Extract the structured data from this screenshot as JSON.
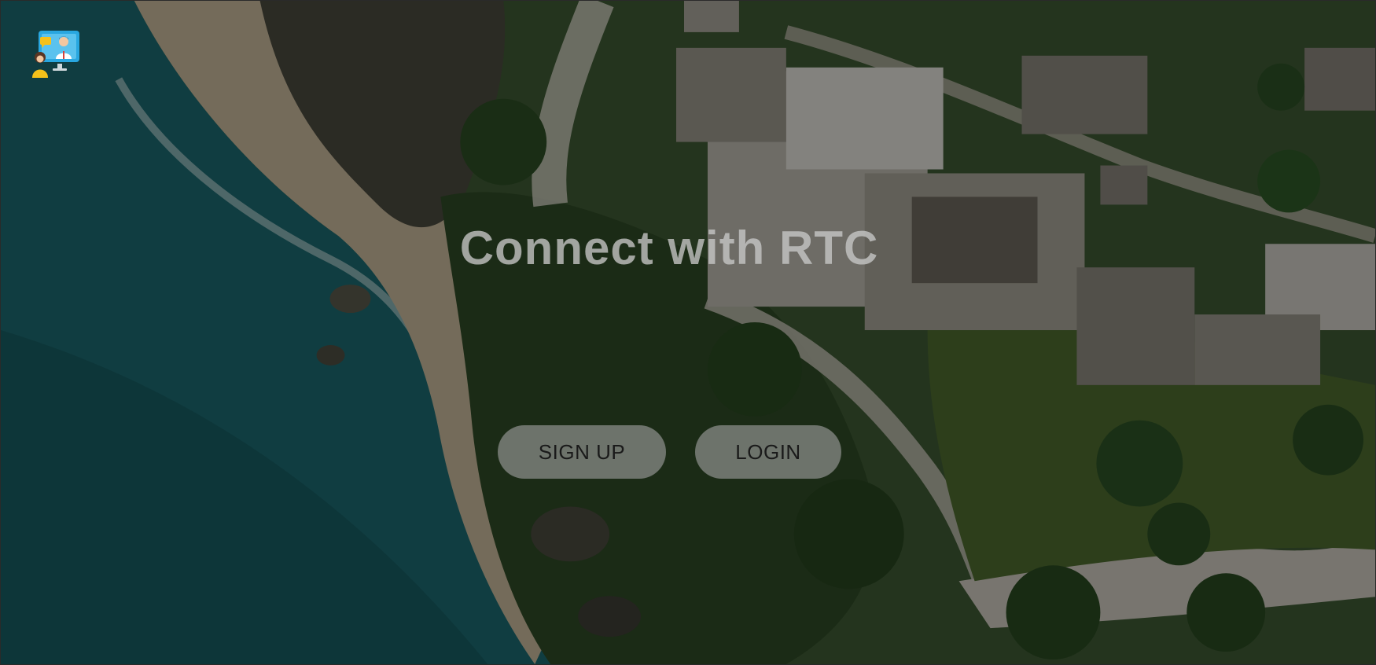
{
  "hero": {
    "title": "Connect with RTC"
  },
  "actions": {
    "signup_label": "SIGN UP",
    "login_label": "LOGIN"
  },
  "logo": {
    "icon": "video-call-icon"
  },
  "background": {
    "icon": "aerial-coast-ruins-photo"
  },
  "colors": {
    "button_bg": "#a0a0a0",
    "title_text": "#c8c8c8",
    "button_text": "#1a1a1a",
    "overlay": "#000000"
  }
}
